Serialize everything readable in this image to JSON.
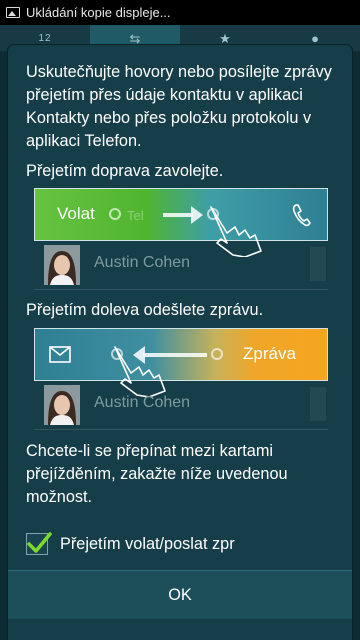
{
  "status_bar": {
    "notification_text": "Ukládání kopie displeje..."
  },
  "background_tabs": [
    {
      "name": "keypad",
      "label": "12"
    },
    {
      "name": "logs",
      "label": ""
    },
    {
      "name": "favorites",
      "label": ""
    },
    {
      "name": "contacts",
      "label": ""
    }
  ],
  "dialog": {
    "intro": "Uskutečňujte hovory nebo posílejte zprávy přejetím přes údaje kontaktu v aplikaci Kontakty nebo přes položku protokolu v aplikaci Telefon.",
    "call_section": {
      "label": "Přejetím doprava zavolejte.",
      "action_label": "Volat"
    },
    "sms_section": {
      "label": "Přejetím doleva odešlete zprávu.",
      "action_label": "Zpráva"
    },
    "demo_contact": {
      "name": "Austin Cohen"
    },
    "footer_note": "Chcete-li se přepínat mezi kartami přejížděním, zakažte níže uvedenou možnost.",
    "checkbox": {
      "label": "Přejetím volat/poslat zpr",
      "checked": true
    },
    "ok_label": "OK"
  },
  "colors": {
    "call_green": "#5cbf3a",
    "sms_orange": "#f6a51f",
    "checkmark": "#7ddc2b",
    "dialog_bg": "#163e48"
  }
}
